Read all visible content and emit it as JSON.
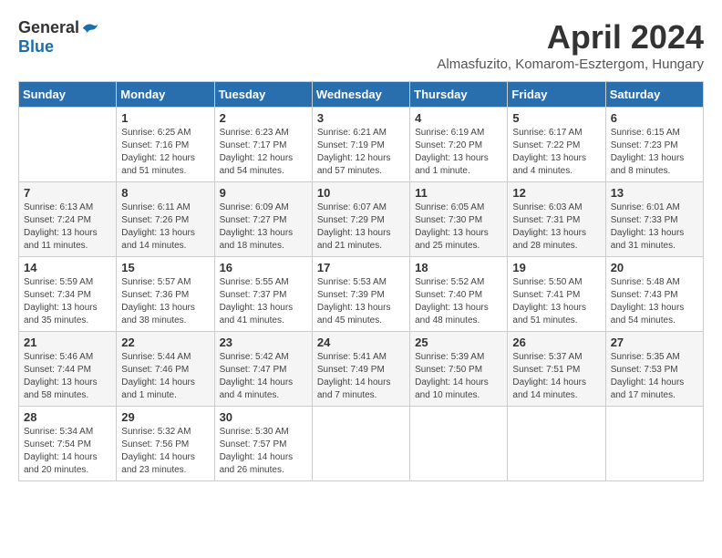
{
  "logo": {
    "general": "General",
    "blue": "Blue"
  },
  "title": "April 2024",
  "location": "Almasfuzito, Komarom-Esztergom, Hungary",
  "days_header": [
    "Sunday",
    "Monday",
    "Tuesday",
    "Wednesday",
    "Thursday",
    "Friday",
    "Saturday"
  ],
  "weeks": [
    [
      {
        "day": "",
        "info": ""
      },
      {
        "day": "1",
        "info": "Sunrise: 6:25 AM\nSunset: 7:16 PM\nDaylight: 12 hours\nand 51 minutes."
      },
      {
        "day": "2",
        "info": "Sunrise: 6:23 AM\nSunset: 7:17 PM\nDaylight: 12 hours\nand 54 minutes."
      },
      {
        "day": "3",
        "info": "Sunrise: 6:21 AM\nSunset: 7:19 PM\nDaylight: 12 hours\nand 57 minutes."
      },
      {
        "day": "4",
        "info": "Sunrise: 6:19 AM\nSunset: 7:20 PM\nDaylight: 13 hours\nand 1 minute."
      },
      {
        "day": "5",
        "info": "Sunrise: 6:17 AM\nSunset: 7:22 PM\nDaylight: 13 hours\nand 4 minutes."
      },
      {
        "day": "6",
        "info": "Sunrise: 6:15 AM\nSunset: 7:23 PM\nDaylight: 13 hours\nand 8 minutes."
      }
    ],
    [
      {
        "day": "7",
        "info": "Sunrise: 6:13 AM\nSunset: 7:24 PM\nDaylight: 13 hours\nand 11 minutes."
      },
      {
        "day": "8",
        "info": "Sunrise: 6:11 AM\nSunset: 7:26 PM\nDaylight: 13 hours\nand 14 minutes."
      },
      {
        "day": "9",
        "info": "Sunrise: 6:09 AM\nSunset: 7:27 PM\nDaylight: 13 hours\nand 18 minutes."
      },
      {
        "day": "10",
        "info": "Sunrise: 6:07 AM\nSunset: 7:29 PM\nDaylight: 13 hours\nand 21 minutes."
      },
      {
        "day": "11",
        "info": "Sunrise: 6:05 AM\nSunset: 7:30 PM\nDaylight: 13 hours\nand 25 minutes."
      },
      {
        "day": "12",
        "info": "Sunrise: 6:03 AM\nSunset: 7:31 PM\nDaylight: 13 hours\nand 28 minutes."
      },
      {
        "day": "13",
        "info": "Sunrise: 6:01 AM\nSunset: 7:33 PM\nDaylight: 13 hours\nand 31 minutes."
      }
    ],
    [
      {
        "day": "14",
        "info": "Sunrise: 5:59 AM\nSunset: 7:34 PM\nDaylight: 13 hours\nand 35 minutes."
      },
      {
        "day": "15",
        "info": "Sunrise: 5:57 AM\nSunset: 7:36 PM\nDaylight: 13 hours\nand 38 minutes."
      },
      {
        "day": "16",
        "info": "Sunrise: 5:55 AM\nSunset: 7:37 PM\nDaylight: 13 hours\nand 41 minutes."
      },
      {
        "day": "17",
        "info": "Sunrise: 5:53 AM\nSunset: 7:39 PM\nDaylight: 13 hours\nand 45 minutes."
      },
      {
        "day": "18",
        "info": "Sunrise: 5:52 AM\nSunset: 7:40 PM\nDaylight: 13 hours\nand 48 minutes."
      },
      {
        "day": "19",
        "info": "Sunrise: 5:50 AM\nSunset: 7:41 PM\nDaylight: 13 hours\nand 51 minutes."
      },
      {
        "day": "20",
        "info": "Sunrise: 5:48 AM\nSunset: 7:43 PM\nDaylight: 13 hours\nand 54 minutes."
      }
    ],
    [
      {
        "day": "21",
        "info": "Sunrise: 5:46 AM\nSunset: 7:44 PM\nDaylight: 13 hours\nand 58 minutes."
      },
      {
        "day": "22",
        "info": "Sunrise: 5:44 AM\nSunset: 7:46 PM\nDaylight: 14 hours\nand 1 minute."
      },
      {
        "day": "23",
        "info": "Sunrise: 5:42 AM\nSunset: 7:47 PM\nDaylight: 14 hours\nand 4 minutes."
      },
      {
        "day": "24",
        "info": "Sunrise: 5:41 AM\nSunset: 7:49 PM\nDaylight: 14 hours\nand 7 minutes."
      },
      {
        "day": "25",
        "info": "Sunrise: 5:39 AM\nSunset: 7:50 PM\nDaylight: 14 hours\nand 10 minutes."
      },
      {
        "day": "26",
        "info": "Sunrise: 5:37 AM\nSunset: 7:51 PM\nDaylight: 14 hours\nand 14 minutes."
      },
      {
        "day": "27",
        "info": "Sunrise: 5:35 AM\nSunset: 7:53 PM\nDaylight: 14 hours\nand 17 minutes."
      }
    ],
    [
      {
        "day": "28",
        "info": "Sunrise: 5:34 AM\nSunset: 7:54 PM\nDaylight: 14 hours\nand 20 minutes."
      },
      {
        "day": "29",
        "info": "Sunrise: 5:32 AM\nSunset: 7:56 PM\nDaylight: 14 hours\nand 23 minutes."
      },
      {
        "day": "30",
        "info": "Sunrise: 5:30 AM\nSunset: 7:57 PM\nDaylight: 14 hours\nand 26 minutes."
      },
      {
        "day": "",
        "info": ""
      },
      {
        "day": "",
        "info": ""
      },
      {
        "day": "",
        "info": ""
      },
      {
        "day": "",
        "info": ""
      }
    ]
  ]
}
